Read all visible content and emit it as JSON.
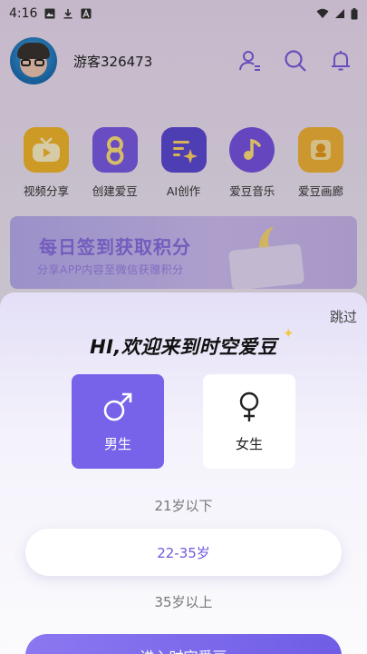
{
  "status_bar": {
    "time": "4:16",
    "icons": [
      "image-icon",
      "download-icon",
      "a-icon",
      "wifi-icon",
      "signal-icon",
      "battery-icon"
    ]
  },
  "header": {
    "username": "游客326473",
    "icons": [
      "profile-edit-icon",
      "search-icon",
      "bell-icon"
    ]
  },
  "menu": {
    "items": [
      {
        "label": "视频分享",
        "icon": "tv-icon",
        "color": "#f5b82e"
      },
      {
        "label": "创建爱豆",
        "icon": "figure-eight-icon",
        "color": "#7b5be8"
      },
      {
        "label": "AI创作",
        "icon": "ai-sparkle-icon",
        "color": "#5d4ad6"
      },
      {
        "label": "爱豆音乐",
        "icon": "music-note-icon",
        "color": "#7a54e4"
      },
      {
        "label": "爱豆画廊",
        "icon": "gallery-icon",
        "color": "#f2b437"
      }
    ]
  },
  "banner": {
    "title": "每日签到获取积分",
    "subtitle": "分享APP内容至微信获赠积分"
  },
  "sheet": {
    "skip_label": "跳过",
    "title": "HI,欢迎来到时空爱豆",
    "gender": {
      "male_label": "男生",
      "female_label": "女生",
      "selected": "男生"
    },
    "age_options": [
      "21岁以下",
      "22-35岁",
      "35岁以上"
    ],
    "age_selected": "22-35岁",
    "enter_label": "进入时空爱豆"
  },
  "colors": {
    "accent": "#7663ea",
    "accent_text": "#6d5ae0"
  }
}
